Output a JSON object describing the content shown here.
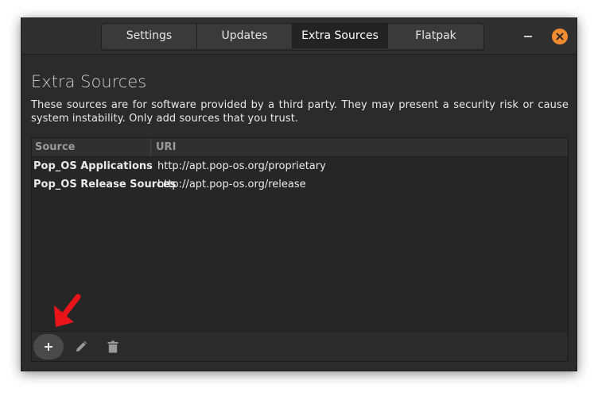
{
  "tabs": [
    {
      "label": "Settings"
    },
    {
      "label": "Updates"
    },
    {
      "label": "Extra Sources"
    },
    {
      "label": "Flatpak"
    }
  ],
  "active_tab": "Extra Sources",
  "page": {
    "title": "Extra Sources",
    "description": "These sources are for software provided by a third party. They may present a security risk or cause system instability. Only add sources that you trust."
  },
  "list": {
    "columns": {
      "source": "Source",
      "uri": "URI"
    },
    "rows": [
      {
        "source": "Pop_OS Applications",
        "uri": "http://apt.pop-os.org/proprietary"
      },
      {
        "source": "Pop_OS Release Sources",
        "uri": "http://apt.pop-os.org/release"
      }
    ]
  },
  "icons": {
    "minimize": "minimize-icon",
    "close": "close-icon",
    "add": "plus-icon",
    "edit": "pencil-icon",
    "delete": "trash-icon",
    "annotation": "red-arrow-icon"
  },
  "colors": {
    "accent": "#f28b30",
    "annotation": "#e8141a",
    "background": "#2b2b2b"
  }
}
